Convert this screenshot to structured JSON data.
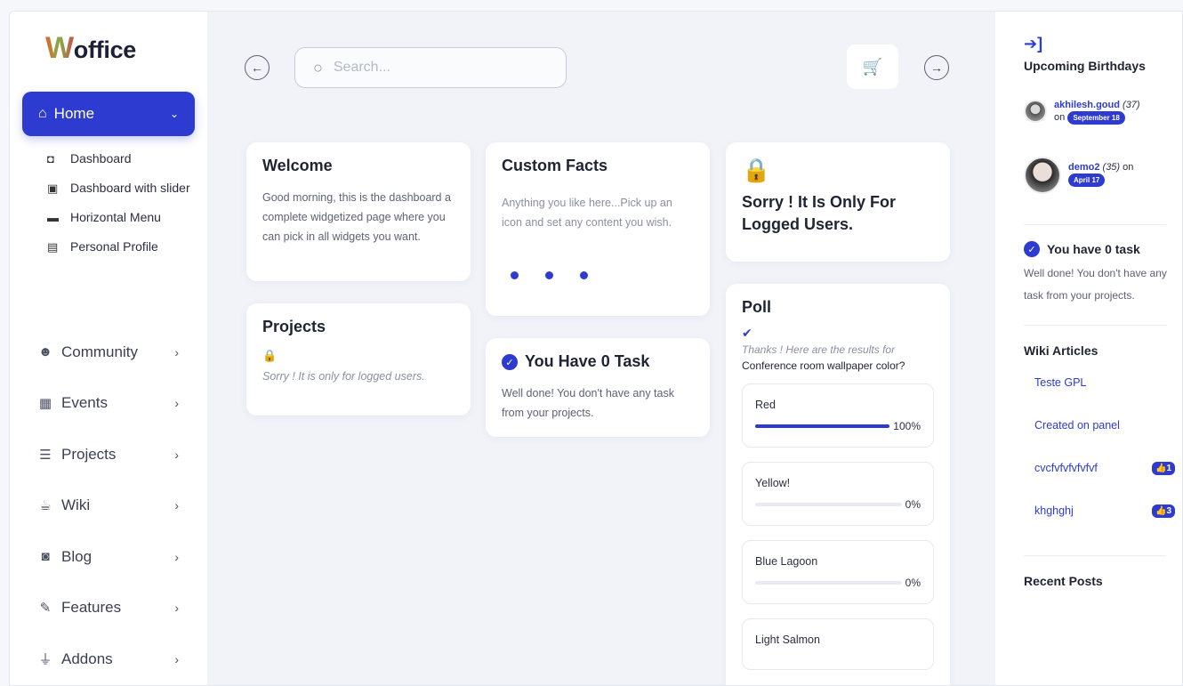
{
  "brand": {
    "logo_initial": "W",
    "logo_rest": "office"
  },
  "sidebar": {
    "home_label": "Home",
    "submenu": [
      {
        "label": "Dashboard",
        "icon": "dashboard-icon"
      },
      {
        "label": "Dashboard with slider",
        "icon": "slider-icon"
      },
      {
        "label": "Horizontal Menu",
        "icon": "horizontal-menu-icon"
      },
      {
        "label": "Personal Profile",
        "icon": "profile-card-icon"
      }
    ],
    "nav": [
      {
        "label": "Community",
        "icon": "users-icon"
      },
      {
        "label": "Events",
        "icon": "calendar-icon"
      },
      {
        "label": "Projects",
        "icon": "list-check-icon"
      },
      {
        "label": "Wiki",
        "icon": "wiki-icon"
      },
      {
        "label": "Blog",
        "icon": "blog-icon"
      },
      {
        "label": "Features",
        "icon": "feather-icon"
      },
      {
        "label": "Addons",
        "icon": "plug-icon"
      }
    ]
  },
  "search": {
    "placeholder": "Search..."
  },
  "cards": {
    "welcome": {
      "title": "Welcome",
      "text": "Good morning, this is the dashboard a complete widgetized page where you can pick in all widgets you want."
    },
    "custom_facts": {
      "title": "Custom Facts",
      "text": "Anything you like here...Pick up an icon and set any content you wish."
    },
    "logged_only": {
      "title": "Sorry ! It Is Only For Logged Users."
    },
    "projects": {
      "title": "Projects",
      "text": "Sorry ! It is only for logged users."
    },
    "task": {
      "title": "You Have 0 Task",
      "text": "Well done! You don't have any task from your projects."
    },
    "poll": {
      "title": "Poll",
      "thanks": "Thanks ! Here are the results for",
      "question": "Conference room wallpaper color?",
      "options": [
        {
          "name": "Red",
          "percent": 100,
          "percent_label": "100%"
        },
        {
          "name": "Yellow!",
          "percent": 0,
          "percent_label": "0%"
        },
        {
          "name": "Blue Lagoon",
          "percent": 0,
          "percent_label": "0%"
        },
        {
          "name": "Light Salmon"
        }
      ]
    }
  },
  "right": {
    "birthdays_title": "Upcoming Birthdays",
    "birthdays": [
      {
        "user": "akhilesh.goud",
        "age": "(37)",
        "on": "on",
        "date": "September 18"
      },
      {
        "user": "demo2",
        "age": "(35)",
        "on": "on",
        "date": "April 17"
      }
    ],
    "task_title": "You have 0 task",
    "task_text": "Well done! You don't have any task from your projects.",
    "wiki_title": "Wiki Articles",
    "wiki": [
      {
        "title": "Teste GPL"
      },
      {
        "title": "Created on panel"
      },
      {
        "title": "cvcfvfvfvfvfvf",
        "likes": "1"
      },
      {
        "title": "khghghj",
        "likes": "3"
      }
    ],
    "recent_posts_title": "Recent Posts"
  },
  "colors": {
    "accent": "#2d3bd1",
    "background": "#f1f3f9"
  }
}
